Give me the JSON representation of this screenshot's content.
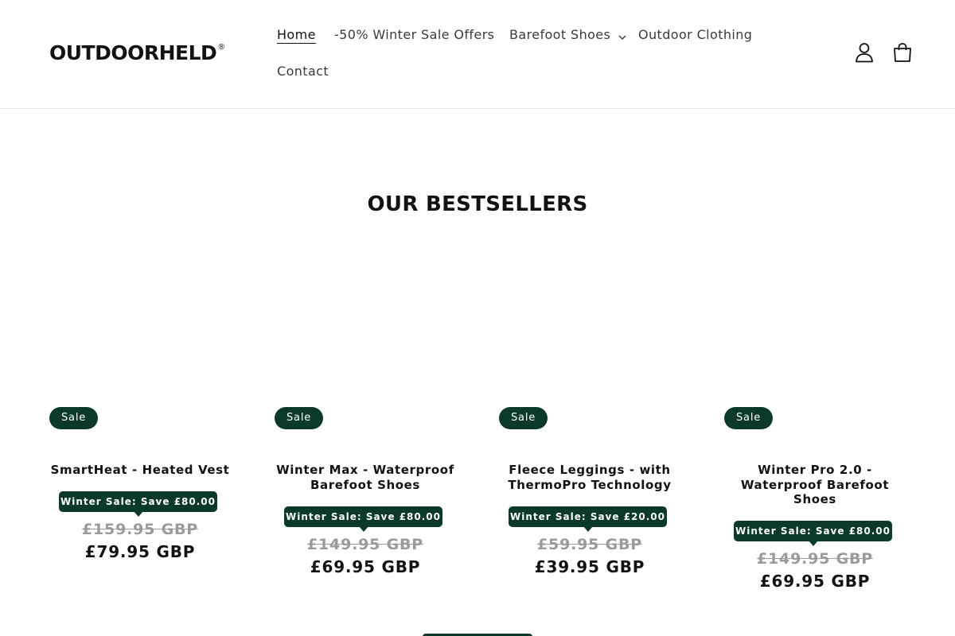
{
  "brand": {
    "name": "OUTDOORHELD",
    "reg_mark": "®"
  },
  "nav": {
    "home": "Home",
    "winter_sale": "-50% Winter Sale Offers",
    "barefoot_shoes": "Barefoot Shoes",
    "outdoor_clothing": "Outdoor Clothing",
    "contact": "Contact"
  },
  "icons": {
    "account": "user-icon",
    "cart": "cart-icon",
    "dropdown": "chevron-down-icon"
  },
  "section": {
    "title": "OUR BESTSELLERS"
  },
  "products": [
    {
      "badge": "Sale",
      "title_lines": [
        "SmartHeat - Heated Vest"
      ],
      "promo": "Winter Sale: Save £80.00",
      "old_price": "£159.95 GBP",
      "new_price": "£79.95 GBP"
    },
    {
      "badge": "Sale",
      "title_lines": [
        "Winter Max - Waterproof",
        "Barefoot Shoes"
      ],
      "promo": "Winter Sale: Save £80.00",
      "old_price": "£149.95 GBP",
      "new_price": "£69.95 GBP"
    },
    {
      "badge": "Sale",
      "title_lines": [
        "Fleece Leggings - with",
        "ThermoPro Technology"
      ],
      "promo": "Winter Sale: Save £20.00",
      "old_price": "£59.95 GBP",
      "new_price": "£39.95 GBP"
    },
    {
      "badge": "Sale",
      "title_lines": [
        "Winter Pro 2.0 -",
        "Waterproof Barefoot",
        "Shoes"
      ],
      "promo": "Winter Sale: Save £80.00",
      "old_price": "£149.95 GBP",
      "new_price": "£69.95 GBP"
    }
  ],
  "colors": {
    "accent": "#0b3a2c",
    "text": "#121212",
    "muted": "#9a9a9a"
  }
}
